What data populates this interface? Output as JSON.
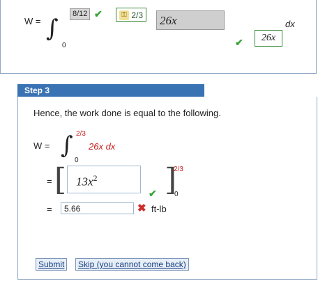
{
  "top": {
    "w_label": "W =",
    "score_badge": "8/12",
    "key_badge": "2/3",
    "input_value": "26x",
    "dx": "dx",
    "lower_limit": "0",
    "answer_shown": "26x"
  },
  "step": {
    "title": "Step 3",
    "description": "Hence, the work done is equal to the following.",
    "w_label": "W =",
    "integral_upper": "2/3",
    "integral_lower": "0",
    "integrand": "26x dx",
    "eq1": "=",
    "antideriv_coef": "13x",
    "antideriv_exp": "2",
    "eval_upper": "2/3",
    "eval_lower": "0",
    "eq2": "=",
    "result_value": "5.66",
    "unit": "ft-lb"
  },
  "buttons": {
    "submit": "Submit",
    "skip": "Skip (you cannot come back)"
  }
}
